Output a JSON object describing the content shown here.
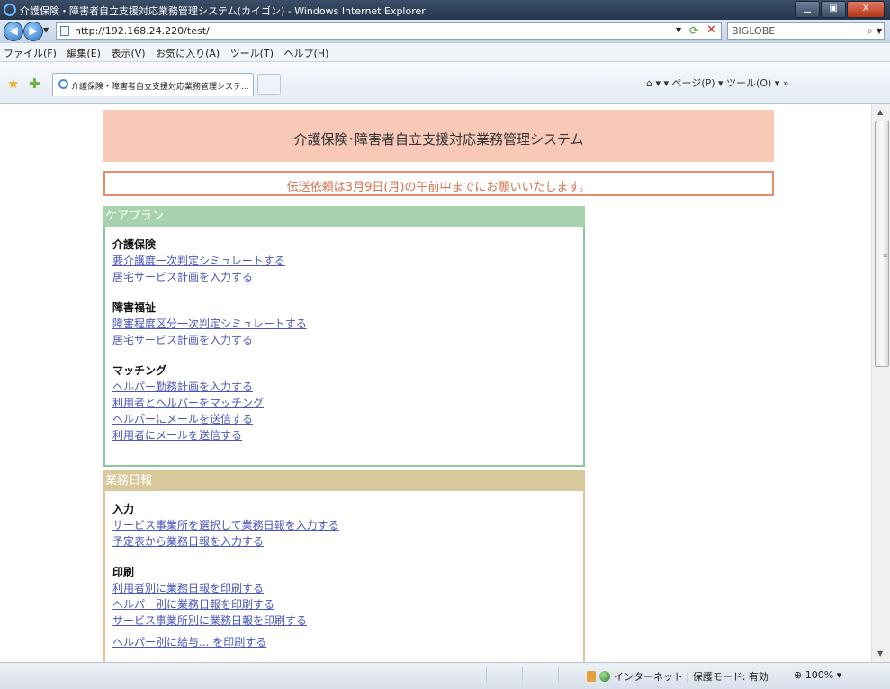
{
  "window": {
    "title": "介護保険・障害者自立支援対応業務管理システム(カイゴン) - Windows Internet Explorer",
    "minimize": "▁",
    "maximize": "▣",
    "close": "X"
  },
  "address": {
    "url": "http://192.168.24.220/test/",
    "search_text": "BIGLOBE"
  },
  "menu": [
    "ファイル(F)",
    "編集(E)",
    "表示(V)",
    "お気に入り(A)",
    "ツール(T)",
    "ヘルプ(H)"
  ],
  "tab": {
    "title": "介護保険・障害者自立支援対応業務管理システ..."
  },
  "command_bar": "▾ ▾ ページ(P) ▾ ツール(O) ▾ »",
  "page": {
    "header_title": "介護保険･障害者自立支援対応業務管理システム",
    "notice": "伝送依頼は3月9日(月)の午前中までにお願いいたします。",
    "careplan": {
      "heading": "ケアプラン",
      "kaigo_title": "介護保険",
      "kaigo_links": [
        "要介護度一次判定シミュレートする",
        "居宅サービス計画を入力する"
      ],
      "shogai_title": "障害福祉",
      "shogai_links": [
        "障害程度区分一次判定シミュレートする",
        "居宅サービス計画を入力する"
      ],
      "matching_title": "マッチング",
      "matching_links": [
        "ヘルパー勤務計画を入力する",
        "利用者とヘルパーをマッチング",
        "ヘルパーにメールを送信する",
        "利用者にメールを送信する"
      ]
    },
    "daily": {
      "heading": "業務日報",
      "input_title": "入力",
      "input_links": [
        "サービス事業所を選択して業務日報を入力する",
        "予定表から業務日報を入力する"
      ],
      "print_title": "印刷",
      "print_links": [
        "利用者別に業務日報を印刷する",
        "ヘルパー別に業務日報を印刷する",
        "サービス事業所別に業務日報を印刷する",
        "ヘルパー別に給与... を印刷する"
      ]
    }
  },
  "status": {
    "zone": "インターネット | 保護モード: 有効",
    "zoom": "100%"
  }
}
